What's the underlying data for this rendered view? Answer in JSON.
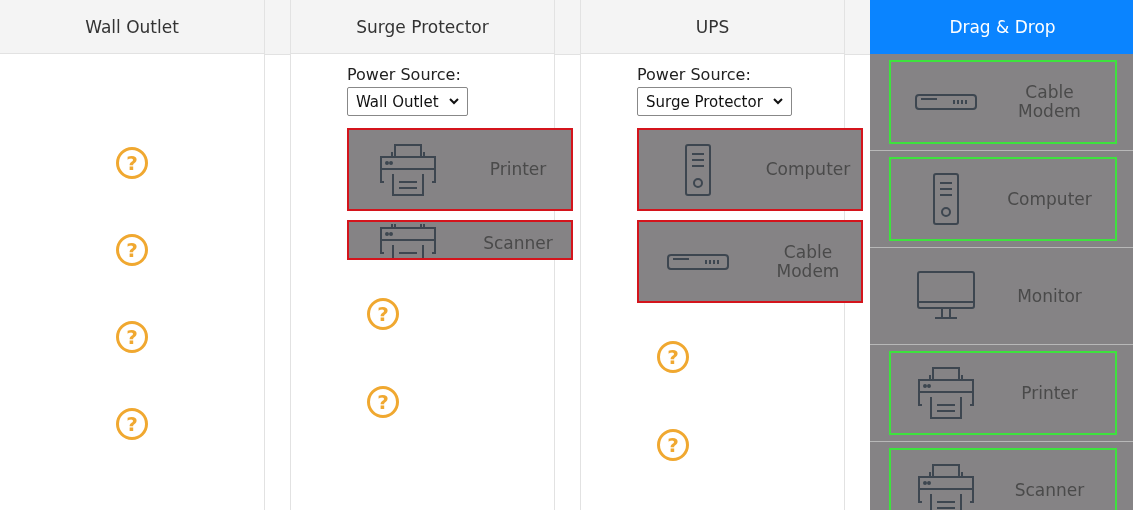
{
  "columns": [
    {
      "title": "Wall Outlet",
      "selected": false,
      "slots": [
        {
          "kind": "empty",
          "mark": "?"
        },
        {
          "kind": "empty",
          "mark": "?"
        },
        {
          "kind": "empty",
          "mark": "?"
        },
        {
          "kind": "empty",
          "mark": "?"
        }
      ]
    },
    {
      "title": "Surge Protector",
      "selected": false,
      "power_source": {
        "label": "Power Source:",
        "value": "Wall Outlet"
      },
      "slots": [
        {
          "kind": "printer",
          "label": "Printer",
          "cut": false
        },
        {
          "kind": "printer",
          "label": "Scanner",
          "cut": true
        },
        {
          "kind": "empty",
          "mark": "?"
        },
        {
          "kind": "empty",
          "mark": "?"
        }
      ]
    },
    {
      "title": "UPS",
      "selected": false,
      "power_source": {
        "label": "Power Source:",
        "value": "Surge Protector"
      },
      "slots": [
        {
          "kind": "computer",
          "label": "Computer",
          "cut": false
        },
        {
          "kind": "modem",
          "label": "Cable Modem",
          "cut": false
        },
        {
          "kind": "empty",
          "mark": "?"
        },
        {
          "kind": "empty",
          "mark": "?"
        }
      ]
    }
  ],
  "bank": {
    "title": "Drag & Drop",
    "selected": true,
    "items": [
      {
        "kind": "modem",
        "label": "Cable Modem",
        "highlighted": true
      },
      {
        "kind": "computer",
        "label": "Computer",
        "highlighted": true
      },
      {
        "kind": "monitor",
        "label": "Monitor",
        "highlighted": false
      },
      {
        "kind": "printer",
        "label": "Printer",
        "highlighted": true
      },
      {
        "kind": "printer",
        "label": "Scanner",
        "highlighted": true
      }
    ]
  }
}
